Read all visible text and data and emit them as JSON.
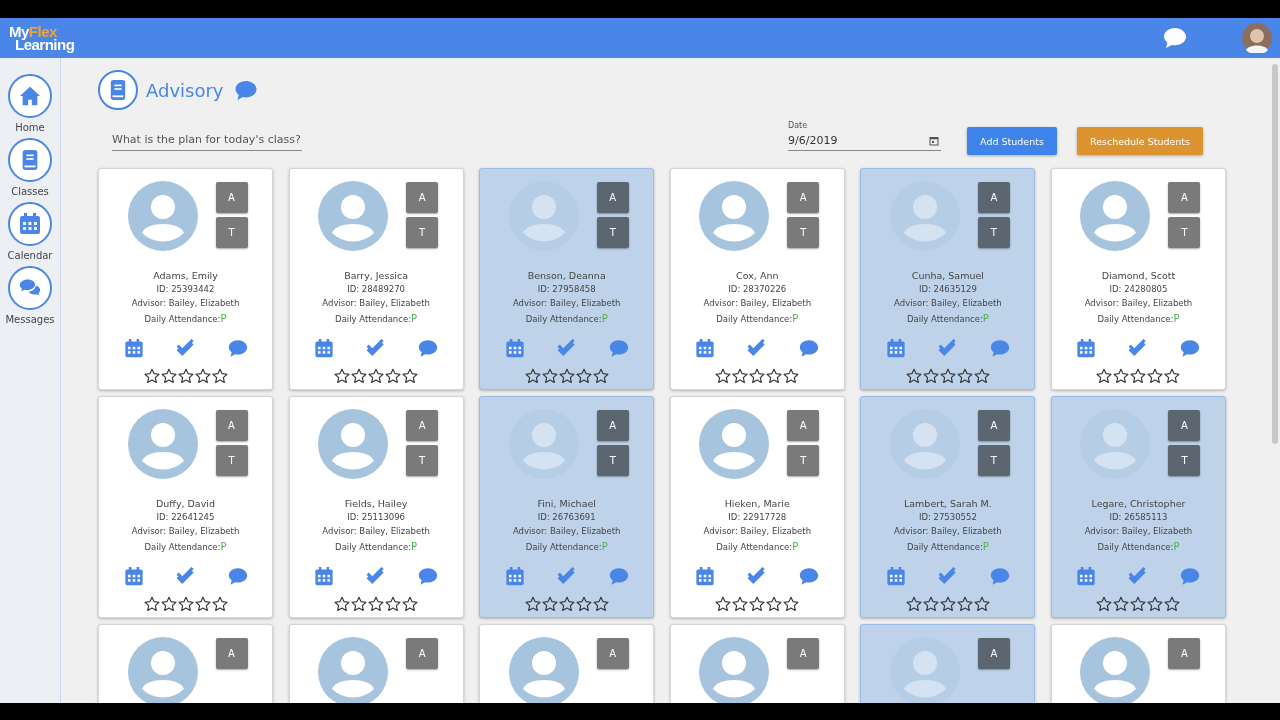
{
  "header": {
    "logo": [
      {
        "text": "My",
        "kind": "plain"
      },
      {
        "text": "Flex",
        "kind": "accent"
      },
      {
        "text": "Learning",
        "kind": "plain"
      }
    ]
  },
  "sidebar": {
    "items": [
      {
        "label": "Home",
        "kind": "home"
      },
      {
        "label": "Classes",
        "kind": "classes"
      },
      {
        "label": "Calendar",
        "kind": "calendar"
      },
      {
        "label": "Messages",
        "kind": "messages"
      }
    ]
  },
  "page": {
    "title": "Advisory",
    "plan": {
      "placeholder": "What is the plan for today's class?"
    },
    "date": {
      "label": "Date",
      "value": "9/6/2019"
    },
    "buttons": [
      {
        "label": "Add Students",
        "kind": "primary"
      },
      {
        "label": "Reschedule Students",
        "kind": "warning"
      }
    ]
  },
  "students": [
    {
      "name": "Adams, Emily",
      "id": "ID: 25393442",
      "advisor": "Advisor: Bailey, Elizabeth",
      "attendance_label": "Daily Attendance:",
      "attendance": "P",
      "stars": 0,
      "selected": false,
      "buttons": [
        "A",
        "T"
      ]
    },
    {
      "name": "Barry, Jessica",
      "id": "ID: 28489270",
      "advisor": "Advisor: Bailey, Elizabeth",
      "attendance_label": "Daily Attendance:",
      "attendance": "P",
      "stars": 0,
      "selected": false,
      "buttons": [
        "A",
        "T"
      ]
    },
    {
      "name": "Benson, Deanna",
      "id": "ID: 27958458",
      "advisor": "Advisor: Bailey, Elizabeth",
      "attendance_label": "Daily Attendance:",
      "attendance": "P",
      "stars": 0,
      "selected": true,
      "buttons": [
        "A",
        "T"
      ]
    },
    {
      "name": "Cox, Ann",
      "id": "ID: 28370226",
      "advisor": "Advisor: Bailey, Elizabeth",
      "attendance_label": "Daily Attendance:",
      "attendance": "P",
      "stars": 0,
      "selected": false,
      "buttons": [
        "A",
        "T"
      ]
    },
    {
      "name": "Cunha, Samuel",
      "id": "ID: 24635129",
      "advisor": "Advisor: Bailey, Elizabeth",
      "attendance_label": "Daily Attendance:",
      "attendance": "P",
      "stars": 0,
      "selected": true,
      "buttons": [
        "A",
        "T"
      ]
    },
    {
      "name": "Diamond, Scott",
      "id": "ID: 24280805",
      "advisor": "Advisor: Bailey, Elizabeth",
      "attendance_label": "Daily Attendance:",
      "attendance": "P",
      "stars": 0,
      "selected": false,
      "buttons": [
        "A",
        "T"
      ]
    },
    {
      "name": "Duffy, David",
      "id": "ID: 22641245",
      "advisor": "Advisor: Bailey, Elizabeth",
      "attendance_label": "Daily Attendance:",
      "attendance": "P",
      "stars": 0,
      "selected": false,
      "buttons": [
        "A",
        "T"
      ]
    },
    {
      "name": "Fields, Hailey",
      "id": "ID: 25113096",
      "advisor": "Advisor: Bailey, Elizabeth",
      "attendance_label": "Daily Attendance:",
      "attendance": "P",
      "stars": 0,
      "selected": false,
      "buttons": [
        "A",
        "T"
      ]
    },
    {
      "name": "Fini, Michael",
      "id": "ID: 26763691",
      "advisor": "Advisor: Bailey, Elizabeth",
      "attendance_label": "Daily Attendance:",
      "attendance": "P",
      "stars": 0,
      "selected": true,
      "buttons": [
        "A",
        "T"
      ]
    },
    {
      "name": "Hieken, Marie",
      "id": "ID: 22917728",
      "advisor": "Advisor: Bailey, Elizabeth",
      "attendance_label": "Daily Attendance:",
      "attendance": "P",
      "stars": 0,
      "selected": false,
      "buttons": [
        "A",
        "T"
      ]
    },
    {
      "name": "Lambert, Sarah M.",
      "id": "ID: 27530552",
      "advisor": "Advisor: Bailey, Elizabeth",
      "attendance_label": "Daily Attendance:",
      "attendance": "P",
      "stars": 0,
      "selected": true,
      "buttons": [
        "A",
        "T"
      ]
    },
    {
      "name": "Legare, Christopher",
      "id": "ID: 26585113",
      "advisor": "Advisor: Bailey, Elizabeth",
      "attendance_label": "Daily Attendance:",
      "attendance": "P",
      "stars": 0,
      "selected": true,
      "buttons": [
        "A",
        "T"
      ]
    },
    {
      "selected": false,
      "buttons": [
        "A"
      ]
    },
    {
      "selected": false,
      "buttons": [
        "A"
      ]
    },
    {
      "selected": false,
      "buttons": [
        "A"
      ]
    },
    {
      "selected": false,
      "buttons": [
        "A"
      ]
    },
    {
      "selected": true,
      "buttons": [
        "A"
      ]
    },
    {
      "selected": false,
      "buttons": [
        "A"
      ]
    }
  ]
}
